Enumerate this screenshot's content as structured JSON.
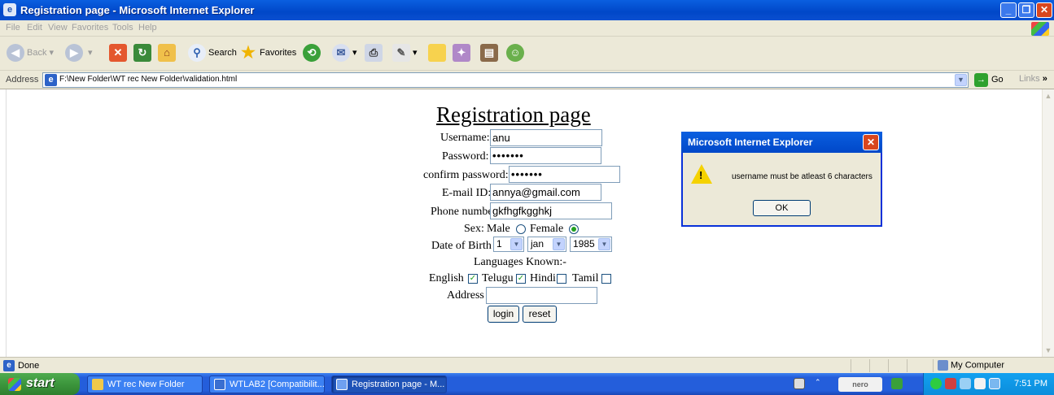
{
  "window": {
    "title": "Registration page - Microsoft Internet Explorer",
    "minimize_glyph": "_",
    "restore_glyph": "❐",
    "close_glyph": "✕"
  },
  "menu": [
    "File",
    "Edit",
    "View",
    "Favorites",
    "Tools",
    "Help"
  ],
  "toolbar": {
    "back_label": "Back",
    "search_label": "Search",
    "favorites_label": "Favorites"
  },
  "address": {
    "label": "Address",
    "url": "F:\\New Folder\\WT rec New Folder\\validation.html",
    "go_label": "Go",
    "links_label": "Links"
  },
  "form": {
    "title": "Registration page",
    "username_label": "Username:",
    "username_value": "anu",
    "password_label": "Password:",
    "password_value": "•••••••",
    "confirm_label": "confirm password:",
    "confirm_value": "•••••••",
    "email_label": "E-mail ID:",
    "email_value": "annya@gmail.com",
    "phone_label": "Phone number:",
    "phone_value": "gkfhgfkgghkj",
    "sex_label": "Sex:",
    "male_label": "Male",
    "female_label": "Female",
    "sex_selected": "Female",
    "dob_label": "Date of Birth",
    "dob_day": "1",
    "dob_month": "jan",
    "dob_year": "1985",
    "languages_label": "Languages Known:-",
    "lang_english": "English",
    "lang_telugu": "Telugu",
    "lang_hindi": "Hindi",
    "lang_tamil": "Tamil",
    "lang_checked": [
      "English",
      "Telugu"
    ],
    "address_label": "Address",
    "address_value": "",
    "login_label": "login",
    "reset_label": "reset"
  },
  "dialog": {
    "title": "Microsoft Internet Explorer",
    "message": "username must be atleast 6 characters",
    "ok_label": "OK",
    "icon": "warning-icon"
  },
  "status": {
    "text": "Done",
    "zone": "My Computer"
  },
  "taskbar": {
    "start_label": "start",
    "tasks": [
      "WT rec New Folder",
      "WTLAB2 [Compatibilit...",
      "Registration page - M..."
    ],
    "active_task": 2,
    "nero_label": "nero",
    "clock": "7:51 PM"
  }
}
